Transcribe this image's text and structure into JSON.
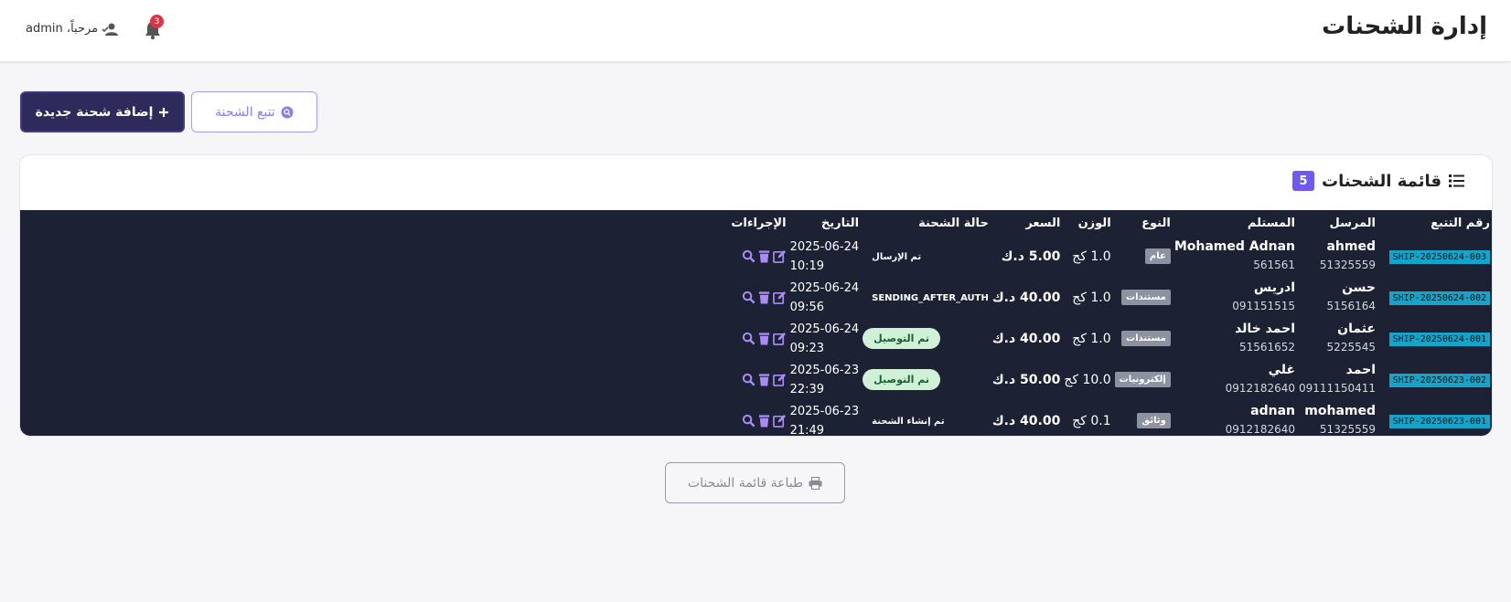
{
  "header": {
    "page_title": "إدارة الشحنات",
    "greeting": "مرحباً، admin",
    "notification_count": "3"
  },
  "toolbar": {
    "add_label": "إضافة شحنة جديدة",
    "track_label": "تتبع الشحنة"
  },
  "list": {
    "title": "قائمة الشحنات",
    "count": "5",
    "columns": [
      "رقم التتبع",
      "المرسل",
      "المستلم",
      "النوع",
      "الوزن",
      "السعر",
      "حالة الشحنة",
      "التاريخ",
      "الإجراءات"
    ],
    "rows": [
      {
        "tracking": "SHIP-20250624-003",
        "sender": "ahmed",
        "sender_phone": "51325559",
        "receiver": "Mohamed Adnan",
        "receiver_phone": "561561",
        "type": "عام",
        "weight": "1.0 كج",
        "price": "5.00",
        "currency": "د.ك",
        "status": "تم الإرسال",
        "status_style": "plain",
        "date": "2025-06-24",
        "time": "10:19"
      },
      {
        "tracking": "SHIP-20250624-002",
        "sender": "حسن",
        "sender_phone": "5156164",
        "receiver": "ادريس",
        "receiver_phone": "091151515",
        "type": "مستندات",
        "weight": "1.0 كج",
        "price": "40.00",
        "currency": "د.ك",
        "status": "SENDING_AFTER_AUTH",
        "status_style": "plain",
        "date": "2025-06-24",
        "time": "09:56"
      },
      {
        "tracking": "SHIP-20250624-001",
        "sender": "عثمان",
        "sender_phone": "5225545",
        "receiver": "احمد خالد",
        "receiver_phone": "51561652",
        "type": "مستندات",
        "weight": "1.0 كج",
        "price": "40.00",
        "currency": "د.ك",
        "status": "تم التوصيل",
        "status_style": "pill",
        "date": "2025-06-24",
        "time": "09:23"
      },
      {
        "tracking": "SHIP-20250623-002",
        "sender": "احمد",
        "sender_phone": "09111150411",
        "receiver": "غلي",
        "receiver_phone": "0912182640",
        "type": "إلكترونيات",
        "weight": "10.0 كج",
        "price": "50.00",
        "currency": "د.ك",
        "status": "تم التوصيل",
        "status_style": "pill",
        "date": "2025-06-23",
        "time": "22:39"
      },
      {
        "tracking": "SHIP-20250623-001",
        "sender": "mohamed",
        "sender_phone": "51325559",
        "receiver": "adnan",
        "receiver_phone": "0912182640",
        "type": "وثائق",
        "weight": "0.1 كج",
        "price": "40.00",
        "currency": "د.ك",
        "status": "تم إنشاء الشحنة",
        "status_style": "plain",
        "date": "2025-06-23",
        "time": "21:49"
      }
    ]
  },
  "footer": {
    "print_label": "طباعة قائمة الشحنات"
  },
  "colors": {
    "primary_dark": "#2e2a5c",
    "accent": "#6f5af0",
    "tracking_badge": "#17a2c8",
    "table_bg": "#1c2233",
    "delivered_pill": "#d1f0d8",
    "notification_badge": "#dc3545"
  },
  "icons": {
    "user": "user-check-icon",
    "bell": "bell-icon",
    "add": "plus-icon",
    "track": "search-circle-icon",
    "list": "list-icon",
    "view": "search-icon",
    "delete": "trash-icon",
    "edit": "edit-icon",
    "print": "printer-icon"
  }
}
